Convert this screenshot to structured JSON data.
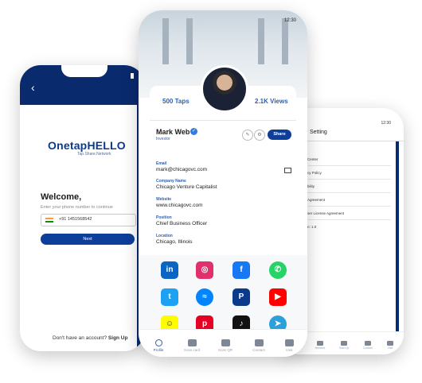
{
  "left_phone": {
    "logo_prefix": "Onetap",
    "logo_brand": "HELLO",
    "tagline": "Tap.Share.Network",
    "welcome": "Welcome,",
    "phone_prompt": "Enter your phone number to continue",
    "phone_value": "+91 1451568542",
    "next_label": "Next",
    "signup_text": "Don't have an account?",
    "signup_link": "Sign Up"
  },
  "center_phone": {
    "status_time": "12:30",
    "taps": "500 Taps",
    "views": "2.1K Views",
    "name": "Mark Web",
    "role": "Investor",
    "share_label": "Share",
    "fields": [
      {
        "label": "Email",
        "value": "mark@chicagovc.com"
      },
      {
        "label": "Company Name",
        "value": "Chicago Venture Capitalist"
      },
      {
        "label": "Website",
        "value": "www.chicagovc.com"
      },
      {
        "label": "Position",
        "value": "Chief Business Officer"
      },
      {
        "label": "Location",
        "value": "Chicago, Illinois"
      }
    ],
    "social": [
      "linkedin-icon",
      "instagram-icon",
      "facebook-icon",
      "whatsapp-icon",
      "twitter-icon",
      "messenger-icon",
      "paypal-icon",
      "youtube-icon",
      "snapchat-icon",
      "pinterest-icon",
      "tiktok-icon",
      "telegram-icon"
    ],
    "nav": [
      "Profile",
      "Scan card",
      "Scan QR",
      "Contact",
      "Visit"
    ]
  },
  "right_phone": {
    "status_time": "12:30",
    "title": "Setting",
    "items": [
      "Center",
      "cy Policy",
      "bility",
      "Agreement",
      "ser License Agreement",
      "n: 1.0"
    ],
    "nav": [
      "Network",
      "Scan Qr",
      "Contact",
      "Visit"
    ]
  }
}
